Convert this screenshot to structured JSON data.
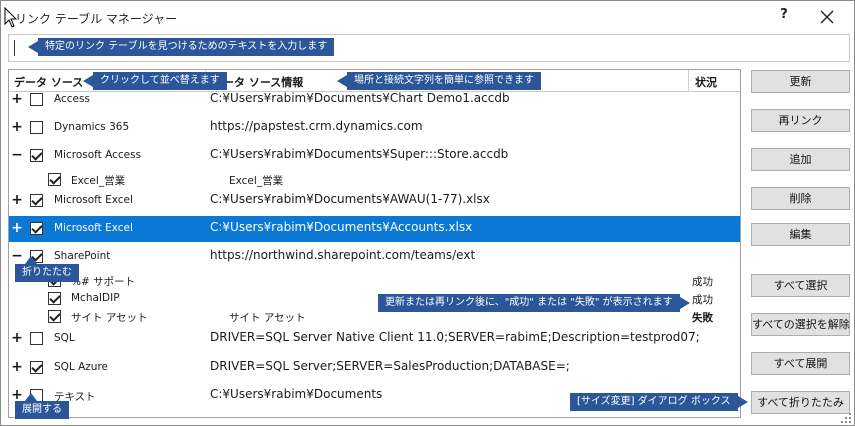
{
  "window": {
    "title": "リンク テーブル マネージャー",
    "help_label": "?",
    "close_icon": "close-icon"
  },
  "search": {
    "value": "",
    "callout": "特定のリンク テーブルを見つけるためのテキストを入力します"
  },
  "grid": {
    "columns": {
      "source": "データ ソース",
      "info": "データ ソース情報",
      "status": "状況"
    },
    "callouts": {
      "sort": "クリックして並べ替えます",
      "info": "場所と接続文字列を簡単に参照できます",
      "collapse": "折りたたむ",
      "status": "更新または再リンク後に、\"成功\" または \"失敗\" が表示されます",
      "expand": "展開する",
      "resize": "[サイズ変更] ダイアログ ボックス"
    },
    "rows": [
      {
        "expander": "+",
        "checked": false,
        "name": "Access",
        "info": "C:¥Users¥rabim¥Documents¥Chart Demo1.accdb",
        "status": ""
      },
      {
        "expander": "+",
        "checked": false,
        "name": "Dynamics 365",
        "info": "https://papstest.crm.dynamics.com",
        "status": ""
      },
      {
        "expander": "−",
        "checked": true,
        "name": "Microsoft Access",
        "info": "C:¥Users¥rabim¥Documents¥Super:::Store.accdb",
        "status": ""
      },
      {
        "expander": "",
        "checked": true,
        "name": "Excel_営業",
        "info": "Excel_営業",
        "status": ""
      },
      {
        "expander": "+",
        "checked": true,
        "name": "Microsoft Excel",
        "info": "C:¥Users¥rabim¥Documents¥AWAU(1-77).xlsx",
        "status": ""
      },
      {
        "expander": "+",
        "checked": true,
        "name": "Microsoft Excel",
        "info": "C:¥Users¥rabim¥Documents¥Accounts.xlsx",
        "status": "",
        "selected": true
      },
      {
        "expander": "−",
        "checked": true,
        "name": "SharePoint",
        "info": "https://northwind.sharepoint.com/teams/ext",
        "status": ""
      },
      {
        "expander": "",
        "checked": true,
        "name": "%# サポート",
        "info": "",
        "status": "成功"
      },
      {
        "expander": "",
        "checked": true,
        "name": "MchaIDIP",
        "info": "",
        "status": "成功"
      },
      {
        "expander": "",
        "checked": true,
        "name": "サイト アセット",
        "info": "サイト アセット",
        "status": "失敗"
      },
      {
        "expander": "+",
        "checked": false,
        "name": "SQL",
        "info": "DRIVER=SQL Server Native Client 11.0;SERVER=rabimE;Description=testprod07;",
        "status": ""
      },
      {
        "expander": "+",
        "checked": true,
        "name": "SQL Azure",
        "info": "DRIVER=SQL Server;SERVER=SalesProduction;DATABASE=;",
        "status": ""
      },
      {
        "expander": "+",
        "checked": false,
        "name": "テキスト",
        "info": "C:¥Users¥rabim¥Documents",
        "status": ""
      }
    ]
  },
  "buttons": {
    "refresh": "更新",
    "relink": "再リンク",
    "add": "追加",
    "delete": "削除",
    "edit": "編集",
    "select_all": "すべて選択",
    "deselect_all": "すべての選択を解除",
    "expand_all": "すべて展開",
    "collapse_all": "すべて折りたたみ"
  }
}
